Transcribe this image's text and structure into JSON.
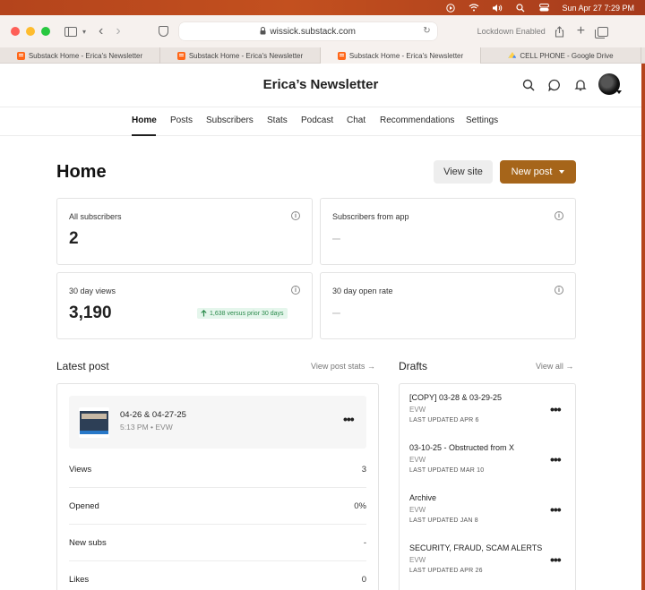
{
  "menubar": {
    "datetime": "Sun Apr 27  7:29 PM"
  },
  "browser": {
    "url": "wissick.substack.com",
    "lockdown_label": "Lockdown Enabled",
    "tabs": [
      {
        "label": "Substack Home - Erica's Newsletter",
        "favicon": "substack-icon"
      },
      {
        "label": "Substack Home - Erica's Newsletter",
        "favicon": "substack-icon"
      },
      {
        "label": "Substack Home - Erica's Newsletter",
        "favicon": "substack-icon",
        "active": true
      },
      {
        "label": "CELL PHONE - Google Drive",
        "favicon": "google-drive-icon"
      }
    ]
  },
  "header": {
    "site_title": "Erica’s Newsletter"
  },
  "nav": {
    "items": [
      "Home",
      "Posts",
      "Subscribers",
      "Stats",
      "Podcast",
      "Chat",
      "Recommendations",
      "Settings"
    ],
    "active": "Home"
  },
  "page": {
    "title": "Home",
    "view_site_label": "View site",
    "new_post_label": "New post"
  },
  "stats": {
    "all_subscribers": {
      "label": "All subscribers",
      "value": "2"
    },
    "subscribers_from_app": {
      "label": "Subscribers from app",
      "value": "–"
    },
    "views_30": {
      "label": "30 day views",
      "value": "3,190",
      "delta": "1,638 versus prior 30 days"
    },
    "open_rate_30": {
      "label": "30 day open rate",
      "value": "–"
    }
  },
  "latest_post": {
    "section_title": "Latest post",
    "link": "View post stats",
    "title": "04-26 & 04-27-25",
    "meta": "5:13 PM • EVW",
    "metrics": [
      {
        "label": "Views",
        "value": "3"
      },
      {
        "label": "Opened",
        "value": "0%"
      },
      {
        "label": "New subs",
        "value": "-"
      },
      {
        "label": "Likes",
        "value": "0"
      }
    ]
  },
  "drafts": {
    "section_title": "Drafts",
    "link": "View all",
    "items": [
      {
        "title": "[COPY] 03-28 & 03-29-25",
        "author": "EVW",
        "updated": "LAST UPDATED APR 6"
      },
      {
        "title": "03-10-25 - Obstructed from X",
        "author": "EVW",
        "updated": "LAST UPDATED MAR 10"
      },
      {
        "title": "Archive",
        "author": "EVW",
        "updated": "LAST UPDATED JAN 8"
      },
      {
        "title": "SECURITY, FRAUD, SCAM ALERTS",
        "author": "EVW",
        "updated": "LAST UPDATED APR 26"
      }
    ]
  },
  "colors": {
    "accent": "#a6651a",
    "positive": "#2a8a4b",
    "menubar": "#b4441c"
  }
}
